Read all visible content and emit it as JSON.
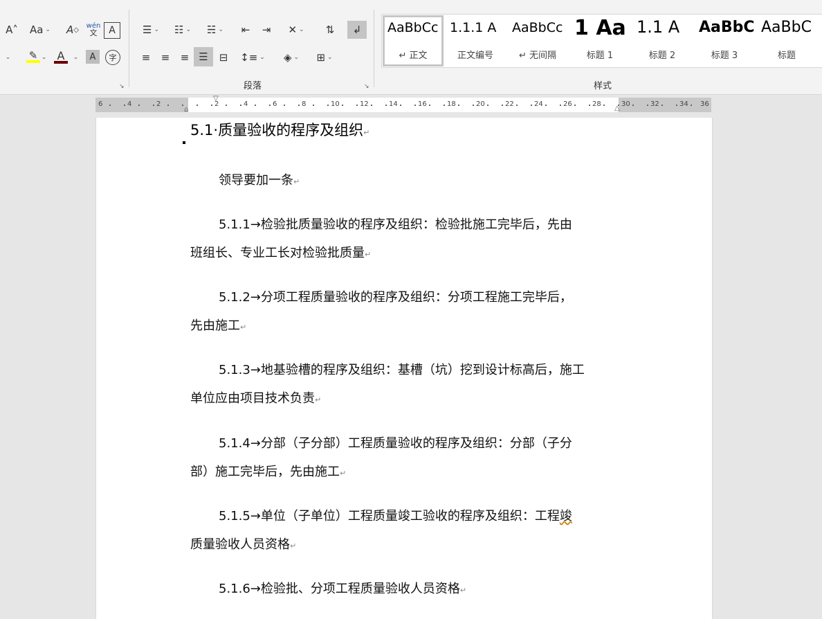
{
  "ribbon": {
    "paragraph_label": "段落",
    "styles_label": "样式",
    "font_buttons": {
      "grow_font": "A˄",
      "change_case": "Aa",
      "clear_format": "A",
      "phonetic_top": "wén",
      "phonetic_bottom": "文",
      "char_border": "A",
      "highlight": "✎",
      "font_color": "A",
      "char_shading": "A",
      "enclose_char": "字"
    },
    "styles": [
      {
        "preview": "AaBbCc",
        "name": "↵ 正文",
        "selected": true
      },
      {
        "preview": "1.1.1 A",
        "name": "正文编号"
      },
      {
        "preview": "AaBbCc",
        "name": "↵ 无间隔"
      },
      {
        "preview": "1 Aa",
        "name": "标题 1"
      },
      {
        "preview": "1.1 A",
        "name": "标题 2"
      },
      {
        "preview": "AaBbC",
        "name": "标题 3"
      },
      {
        "preview": "AaBbC",
        "name": "标题"
      }
    ]
  },
  "ruler": {
    "ticks": [
      "6",
      "4",
      "2",
      "2",
      "2",
      "4",
      "6",
      "8",
      "10",
      "12",
      "14",
      "16",
      "18",
      "20",
      "22",
      "24",
      "26",
      "28",
      "30",
      "32",
      "34",
      "36"
    ]
  },
  "document": {
    "heading": "5.1·质量验收的程序及组织",
    "paragraphs": [
      {
        "line1": "领导要加一条",
        "line2": ""
      },
      {
        "line1": "5.1.1→检验批质量验收的程序及组织：检验批施工完毕后，先由",
        "line2": "班组长、专业工长对检验批质量"
      },
      {
        "line1": "5.1.2→分项工程质量验收的程序及组织：分项工程施工完毕后，",
        "line2": "先由施工"
      },
      {
        "line1": "5.1.3→地基验槽的程序及组织：基槽（坑）挖到设计标高后，施工",
        "line2": "单位应由项目技术负责"
      },
      {
        "line1": "5.1.4→分部（子分部）工程质量验收的程序及组织：分部（子分",
        "line2": "部）施工完毕后，先由施工"
      },
      {
        "line1a": "5.1.5→单位（子单位）工程质量竣工验收的程序及组织：工程",
        "line1b": "竣",
        "line2": "质量验收人员资格"
      },
      {
        "line1": "5.1.6→检验批、分项工程质量验收人员资格",
        "line2": ""
      }
    ],
    "paragraph_mark": "↵"
  },
  "colors": {
    "highlight_bar": "#ffff00",
    "font_color_bar": "#c00000",
    "accent_border": "#c6c6c6"
  }
}
